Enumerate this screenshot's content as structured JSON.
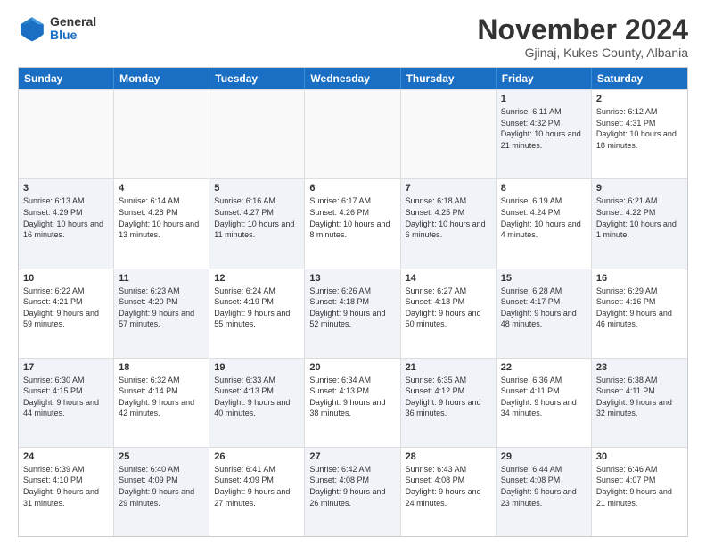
{
  "logo": {
    "general": "General",
    "blue": "Blue"
  },
  "title": "November 2024",
  "location": "Gjinaj, Kukes County, Albania",
  "header_days": [
    "Sunday",
    "Monday",
    "Tuesday",
    "Wednesday",
    "Thursday",
    "Friday",
    "Saturday"
  ],
  "rows": [
    [
      {
        "day": "",
        "content": "",
        "empty": true
      },
      {
        "day": "",
        "content": "",
        "empty": true
      },
      {
        "day": "",
        "content": "",
        "empty": true
      },
      {
        "day": "",
        "content": "",
        "empty": true
      },
      {
        "day": "",
        "content": "",
        "empty": true
      },
      {
        "day": "1",
        "content": "Sunrise: 6:11 AM\nSunset: 4:32 PM\nDaylight: 10 hours and 21 minutes.",
        "alt": true
      },
      {
        "day": "2",
        "content": "Sunrise: 6:12 AM\nSunset: 4:31 PM\nDaylight: 10 hours and 18 minutes.",
        "alt": false
      }
    ],
    [
      {
        "day": "3",
        "content": "Sunrise: 6:13 AM\nSunset: 4:29 PM\nDaylight: 10 hours and 16 minutes.",
        "alt": true
      },
      {
        "day": "4",
        "content": "Sunrise: 6:14 AM\nSunset: 4:28 PM\nDaylight: 10 hours and 13 minutes.",
        "alt": false
      },
      {
        "day": "5",
        "content": "Sunrise: 6:16 AM\nSunset: 4:27 PM\nDaylight: 10 hours and 11 minutes.",
        "alt": true
      },
      {
        "day": "6",
        "content": "Sunrise: 6:17 AM\nSunset: 4:26 PM\nDaylight: 10 hours and 8 minutes.",
        "alt": false
      },
      {
        "day": "7",
        "content": "Sunrise: 6:18 AM\nSunset: 4:25 PM\nDaylight: 10 hours and 6 minutes.",
        "alt": true
      },
      {
        "day": "8",
        "content": "Sunrise: 6:19 AM\nSunset: 4:24 PM\nDaylight: 10 hours and 4 minutes.",
        "alt": false
      },
      {
        "day": "9",
        "content": "Sunrise: 6:21 AM\nSunset: 4:22 PM\nDaylight: 10 hours and 1 minute.",
        "alt": true
      }
    ],
    [
      {
        "day": "10",
        "content": "Sunrise: 6:22 AM\nSunset: 4:21 PM\nDaylight: 9 hours and 59 minutes.",
        "alt": false
      },
      {
        "day": "11",
        "content": "Sunrise: 6:23 AM\nSunset: 4:20 PM\nDaylight: 9 hours and 57 minutes.",
        "alt": true
      },
      {
        "day": "12",
        "content": "Sunrise: 6:24 AM\nSunset: 4:19 PM\nDaylight: 9 hours and 55 minutes.",
        "alt": false
      },
      {
        "day": "13",
        "content": "Sunrise: 6:26 AM\nSunset: 4:18 PM\nDaylight: 9 hours and 52 minutes.",
        "alt": true
      },
      {
        "day": "14",
        "content": "Sunrise: 6:27 AM\nSunset: 4:18 PM\nDaylight: 9 hours and 50 minutes.",
        "alt": false
      },
      {
        "day": "15",
        "content": "Sunrise: 6:28 AM\nSunset: 4:17 PM\nDaylight: 9 hours and 48 minutes.",
        "alt": true
      },
      {
        "day": "16",
        "content": "Sunrise: 6:29 AM\nSunset: 4:16 PM\nDaylight: 9 hours and 46 minutes.",
        "alt": false
      }
    ],
    [
      {
        "day": "17",
        "content": "Sunrise: 6:30 AM\nSunset: 4:15 PM\nDaylight: 9 hours and 44 minutes.",
        "alt": true
      },
      {
        "day": "18",
        "content": "Sunrise: 6:32 AM\nSunset: 4:14 PM\nDaylight: 9 hours and 42 minutes.",
        "alt": false
      },
      {
        "day": "19",
        "content": "Sunrise: 6:33 AM\nSunset: 4:13 PM\nDaylight: 9 hours and 40 minutes.",
        "alt": true
      },
      {
        "day": "20",
        "content": "Sunrise: 6:34 AM\nSunset: 4:13 PM\nDaylight: 9 hours and 38 minutes.",
        "alt": false
      },
      {
        "day": "21",
        "content": "Sunrise: 6:35 AM\nSunset: 4:12 PM\nDaylight: 9 hours and 36 minutes.",
        "alt": true
      },
      {
        "day": "22",
        "content": "Sunrise: 6:36 AM\nSunset: 4:11 PM\nDaylight: 9 hours and 34 minutes.",
        "alt": false
      },
      {
        "day": "23",
        "content": "Sunrise: 6:38 AM\nSunset: 4:11 PM\nDaylight: 9 hours and 32 minutes.",
        "alt": true
      }
    ],
    [
      {
        "day": "24",
        "content": "Sunrise: 6:39 AM\nSunset: 4:10 PM\nDaylight: 9 hours and 31 minutes.",
        "alt": false
      },
      {
        "day": "25",
        "content": "Sunrise: 6:40 AM\nSunset: 4:09 PM\nDaylight: 9 hours and 29 minutes.",
        "alt": true
      },
      {
        "day": "26",
        "content": "Sunrise: 6:41 AM\nSunset: 4:09 PM\nDaylight: 9 hours and 27 minutes.",
        "alt": false
      },
      {
        "day": "27",
        "content": "Sunrise: 6:42 AM\nSunset: 4:08 PM\nDaylight: 9 hours and 26 minutes.",
        "alt": true
      },
      {
        "day": "28",
        "content": "Sunrise: 6:43 AM\nSunset: 4:08 PM\nDaylight: 9 hours and 24 minutes.",
        "alt": false
      },
      {
        "day": "29",
        "content": "Sunrise: 6:44 AM\nSunset: 4:08 PM\nDaylight: 9 hours and 23 minutes.",
        "alt": true
      },
      {
        "day": "30",
        "content": "Sunrise: 6:46 AM\nSunset: 4:07 PM\nDaylight: 9 hours and 21 minutes.",
        "alt": false
      }
    ]
  ]
}
